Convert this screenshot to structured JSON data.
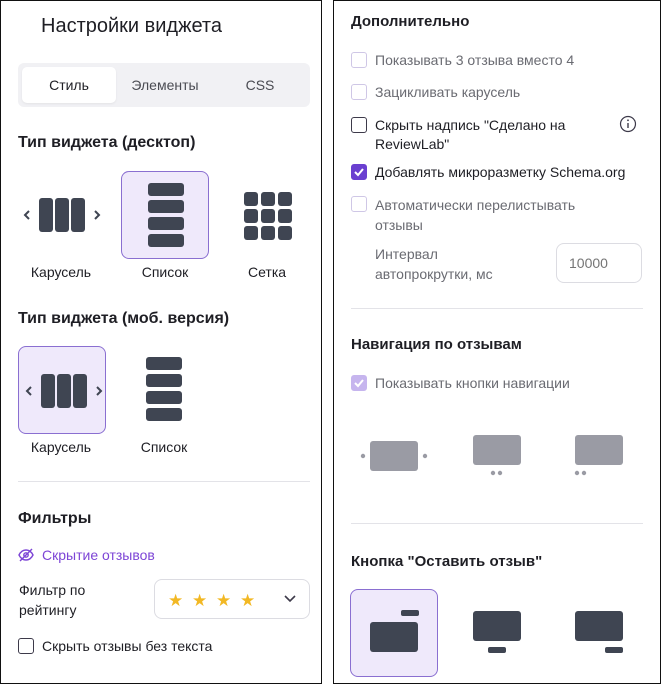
{
  "left": {
    "title": "Настройки виджета",
    "tabs": [
      {
        "label": "Стиль",
        "active": true
      },
      {
        "label": "Элементы",
        "active": false
      },
      {
        "label": "CSS",
        "active": false
      }
    ],
    "desktop_type": {
      "title": "Тип виджета (десктоп)",
      "options": [
        {
          "label": "Карусель",
          "icon": "carousel-icon",
          "selected": false
        },
        {
          "label": "Список",
          "icon": "list-icon",
          "selected": true
        },
        {
          "label": "Сетка",
          "icon": "grid-icon",
          "selected": false
        }
      ]
    },
    "mobile_type": {
      "title": "Тип виджета (моб. версия)",
      "options": [
        {
          "label": "Карусель",
          "icon": "carousel-icon",
          "selected": true
        },
        {
          "label": "Список",
          "icon": "list-icon",
          "selected": false
        }
      ]
    },
    "filters": {
      "title": "Фильтры",
      "hide_reviews_link": "Скрытие отзывов",
      "rating_filter_label": "Фильтр по рейтингу",
      "rating_stars": 4,
      "hide_without_text_label": "Скрыть отзывы без текста",
      "hide_without_text_checked": false
    }
  },
  "right": {
    "additional": {
      "title": "Дополнительно",
      "options": [
        {
          "label": "Показывать 3 отзыва вместо 4",
          "checked": false,
          "enabled": false
        },
        {
          "label": "Зацикливать карусель",
          "checked": false,
          "enabled": false
        },
        {
          "label": "Скрыть надпись \"Сделано на ReviewLab\"",
          "checked": false,
          "enabled": true,
          "has_info": true
        },
        {
          "label": "Добавлять микроразметку Schema.org",
          "checked": true,
          "enabled": true
        },
        {
          "label": "Автоматически перелистывать отзывы",
          "checked": false,
          "enabled": false
        }
      ],
      "interval_label": "Интервал автопрокрутки, мс",
      "interval_placeholder": "10000"
    },
    "navigation": {
      "title": "Навигация по отзывам",
      "show_buttons_label": "Показывать кнопки навигации",
      "show_buttons_checked": true
    },
    "leave_review": {
      "title": "Кнопка \"Оставить отзыв\"",
      "selected_index": 0
    }
  },
  "colors": {
    "accent": "#6a3fd0",
    "accent_light": "#efe9fb",
    "icon_dark": "#3f4552",
    "icon_gray": "#9a9ba4",
    "star": "#f2b824"
  }
}
